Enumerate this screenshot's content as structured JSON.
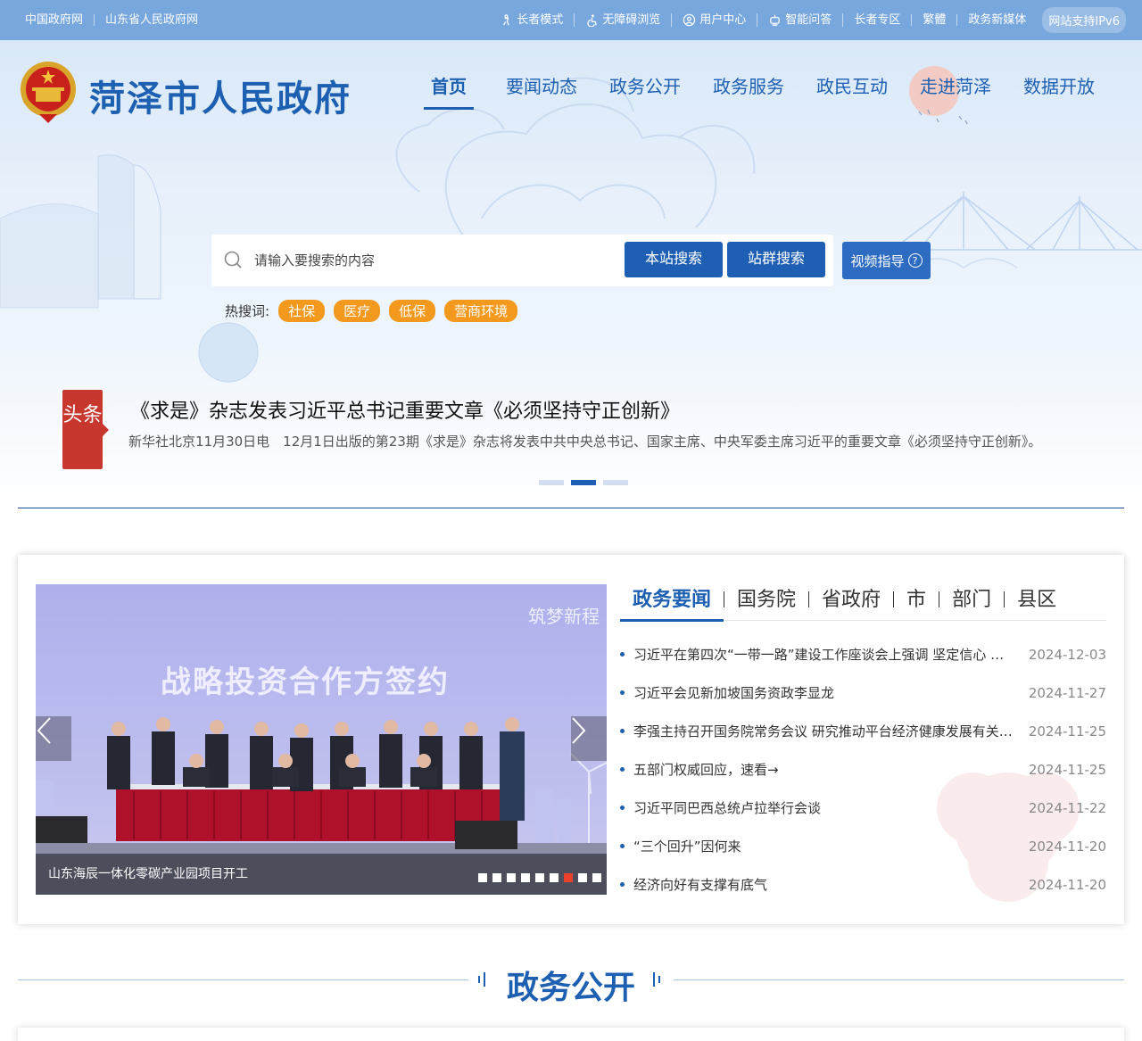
{
  "topbar": {
    "left_links": [
      "中国政府网",
      "山东省人民政府网"
    ],
    "right_links": [
      {
        "label": "长者模式",
        "icon": "elder-icon"
      },
      {
        "label": "无障碍浏览",
        "icon": "accessibility-icon"
      },
      {
        "label": "用户中心",
        "icon": "user-icon"
      },
      {
        "label": "智能问答",
        "icon": "robot-icon"
      },
      {
        "label": "长者专区",
        "icon": ""
      },
      {
        "label": "繁體",
        "icon": ""
      },
      {
        "label": "政务新媒体",
        "icon": ""
      }
    ],
    "ipv6": "网站支持IPv6"
  },
  "header": {
    "site_title": "菏泽市人民政府",
    "nav": [
      "首页",
      "要闻动态",
      "政务公开",
      "政务服务",
      "政民互动",
      "走进菏泽",
      "数据开放"
    ],
    "active_nav": "首页"
  },
  "search": {
    "placeholder": "请输入要搜索的内容",
    "site_search": "本站搜索",
    "group_search": "站群搜索",
    "video_guide": "视频指导",
    "hot_label": "热搜词:",
    "hot_tags": [
      "社保",
      "医疗",
      "低保",
      "营商环境"
    ]
  },
  "headline": {
    "badge": "头条",
    "title": "《求是》杂志发表习近平总书记重要文章《必须坚持守正创新》",
    "desc": "新华社北京11月30日电　12月1日出版的第23期《求是》杂志将发表中共中央总书记、国家主席、中央军委主席习近平的重要文章《必须坚持守正创新》。",
    "dots_count": 3,
    "active_dot": 1
  },
  "slider": {
    "banner_text": "战略投资合作方签约",
    "brand_text": "筑梦新程",
    "caption": "山东海辰一体化零碳产业园项目开工",
    "dots_count": 9,
    "active_dot": 6
  },
  "news": {
    "tabs": [
      "政务要闻",
      "国务院",
      "省政府",
      "市",
      "部门",
      "县区"
    ],
    "active_tab": "政务要闻",
    "items": [
      {
        "title": "习近平在第四次“一带一路”建设工作座谈会上强调 坚定信心 开拓进取 推动共建“一带一路”高质量发展",
        "date": "2024-12-03"
      },
      {
        "title": "习近平会见新加坡国务资政李显龙",
        "date": "2024-11-27"
      },
      {
        "title": "李强主持召开国务院常务会议 研究推动平台经济健康发展有关举措",
        "date": "2024-11-25"
      },
      {
        "title": "五部门权威回应，速看→",
        "date": "2024-11-25"
      },
      {
        "title": "习近平同巴西总统卢拉举行会谈",
        "date": "2024-11-22"
      },
      {
        "title": "“三个回升”因何来",
        "date": "2024-11-20"
      },
      {
        "title": "经济向好有支撑有底气",
        "date": "2024-11-20"
      }
    ]
  },
  "section": {
    "title": "政务公开"
  },
  "colors": {
    "primary": "#1d5fb0",
    "topbar": "#77a7dd",
    "hot_tag": "#f39a1e",
    "headline_badge": "#c8372d"
  }
}
